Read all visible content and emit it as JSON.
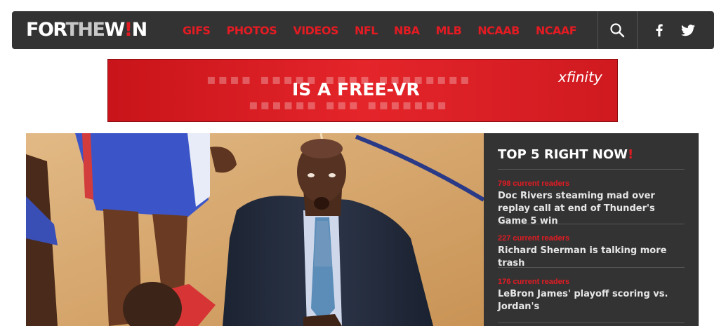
{
  "header": {
    "logo": {
      "part1": "FOR",
      "part2": "THE",
      "part3": "W",
      "part4": "!",
      "part5": "N"
    },
    "nav": [
      "GIFS",
      "PHOTOS",
      "VIDEOS",
      "NFL",
      "NBA",
      "MLB",
      "NCAAB",
      "NCAAF"
    ],
    "icons": [
      "search-icon",
      "facebook-icon",
      "twitter-icon"
    ],
    "colors": {
      "bar": "#333333",
      "accent": "#e31b23"
    }
  },
  "ad": {
    "headline": "IS A FREE-VR",
    "brand": "xfinity",
    "background": "#d91f25"
  },
  "top5": {
    "title": "TOP 5 RIGHT NOW",
    "title_mark": "!",
    "stories": [
      {
        "readers": "798 current readers",
        "headline": "Doc Rivers steaming mad over replay call at end of Thunder's Game 5 win"
      },
      {
        "readers": "227 current readers",
        "headline": "Richard Sherman is talking more trash"
      },
      {
        "readers": "176 current readers",
        "headline": "LeBron James' playoff scoring vs. Jordan's"
      }
    ]
  }
}
